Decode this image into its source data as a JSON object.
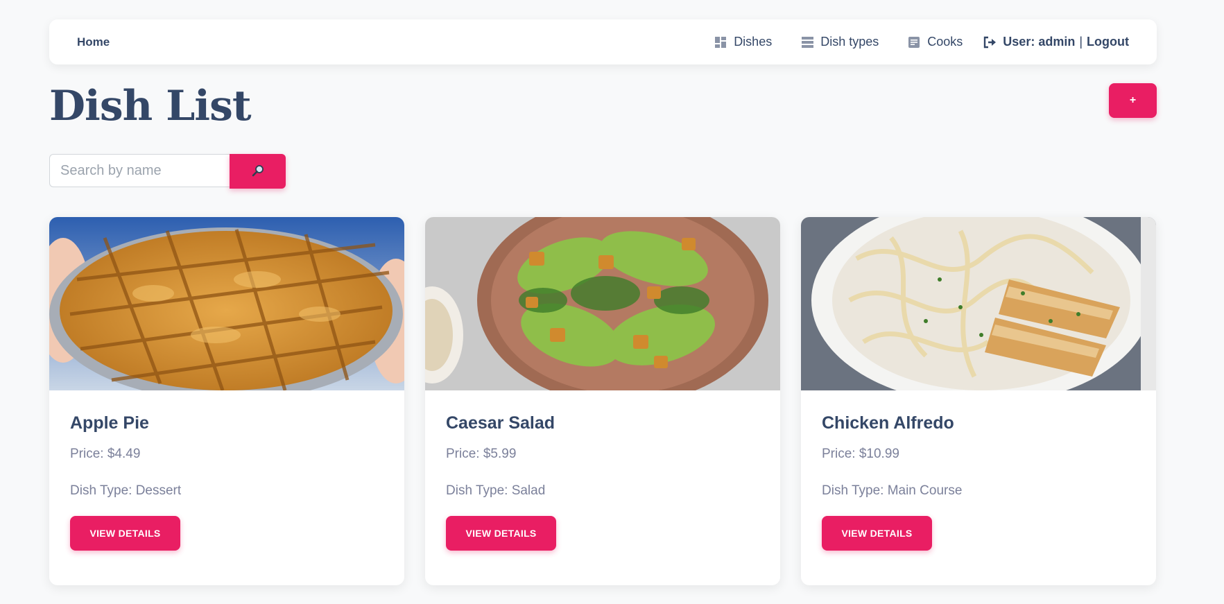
{
  "nav": {
    "home": "Home",
    "dishes": "Dishes",
    "dish_types": "Dish types",
    "cooks": "Cooks",
    "user": "User: admin",
    "separator": "|",
    "logout": "Logout"
  },
  "page": {
    "title": "Dish List",
    "add_label": "+"
  },
  "search": {
    "placeholder": "Search by name",
    "value": ""
  },
  "colors": {
    "accent": "#e91e63",
    "heading": "#344767",
    "muted": "#7b809a"
  },
  "dishes": [
    {
      "name": "Apple Pie",
      "price": "Price: $4.49",
      "type": "Dish Type: Dessert",
      "button": "VIEW DETAILS",
      "image": "apple-pie-photo"
    },
    {
      "name": "Caesar Salad",
      "price": "Price: $5.99",
      "type": "Dish Type: Salad",
      "button": "VIEW DETAILS",
      "image": "caesar-salad-photo"
    },
    {
      "name": "Chicken Alfredo",
      "price": "Price: $10.99",
      "type": "Dish Type: Main Course",
      "button": "VIEW DETAILS",
      "image": "chicken-alfredo-photo"
    }
  ]
}
